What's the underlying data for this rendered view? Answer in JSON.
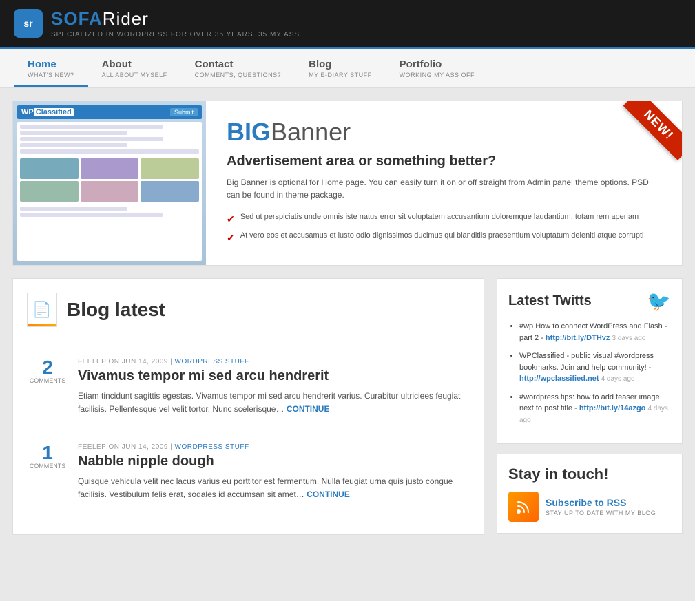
{
  "site": {
    "logo_abbr": "sr",
    "logo_name_part1": "SOFA",
    "logo_name_part2": "Rider",
    "tagline": "SPECIALIZED IN WORDPRESS FOR OVER 35 YEARS. 35 MY ASS."
  },
  "nav": {
    "items": [
      {
        "id": "home",
        "label": "Home",
        "sub": "WHAT'S NEW?",
        "active": true
      },
      {
        "id": "about",
        "label": "About",
        "sub": "ALL ABOUT MYSELF",
        "active": false
      },
      {
        "id": "contact",
        "label": "Contact",
        "sub": "COMMENTS, QUESTIONS?",
        "active": false
      },
      {
        "id": "blog",
        "label": "Blog",
        "sub": "MY E-DIARY STUFF",
        "active": false
      },
      {
        "id": "portfolio",
        "label": "Portfolio",
        "sub": "WORKING MY ASS OFF",
        "active": false
      }
    ]
  },
  "banner": {
    "title_big": "BIG",
    "title_rest": "Banner",
    "subtitle": "Advertisement area or something better?",
    "desc": "Big Banner is optional for Home page. You can easily turn it on or off straight from Admin panel theme options. PSD can be found in theme package.",
    "bullets": [
      "Sed ut perspiciatis unde omnis iste natus error sit voluptatem accusantium doloremque laudantium, totam rem aperiam",
      "At vero eos et accusamus et iusto odio dignissimos ducimus qui blanditiis praesentium voluptatum deleniti atque corrupti"
    ],
    "new_label": "NEW!"
  },
  "blog": {
    "section_title": "Blog latest",
    "posts": [
      {
        "id": "post-1",
        "author": "FEELEP",
        "date": "JUN 14, 2009",
        "category": "WORDPRESS STUFF",
        "title": "Vivamus tempor mi sed arcu hendrerit",
        "excerpt": "Etiam tincidunt sagittis egestas. Vivamus tempor mi sed arcu hendrerit varius. Curabitur ultriciees feugiat facilisis. Pellentesque vel velit tortor. Nunc scelerisque…",
        "continue": "CONTINUE",
        "comments": 2,
        "comments_label": "COMMENTS"
      },
      {
        "id": "post-2",
        "author": "FEELEP",
        "date": "JUN 14, 2009",
        "category": "WORDPRESS STUFF",
        "title": "Nabble nipple dough",
        "excerpt": "Quisque vehicula velit nec lacus varius eu porttitor est fermentum. Nulla feugiat urna quis justo congue facilisis. Vestibulum felis erat, sodales id accumsan sit amet…",
        "continue": "CONTINUE",
        "comments": 1,
        "comments_label": "COMMENTS"
      }
    ]
  },
  "sidebar": {
    "twitter": {
      "title": "Latest Twitts",
      "items": [
        {
          "text": "#wp How to connect WordPress and Flash - part 2 -",
          "link": "http://bit.ly/DTHvz",
          "days_ago": "3 days ago"
        },
        {
          "text": "WPClassified - public visual #wordpress bookmarks. Join and help community! -",
          "link": "http://wpclassified.net",
          "days_ago": "4 days ago"
        },
        {
          "text": "#wordpress tips: how to add teaser image next to post title -",
          "link": "http://bit.ly/14azgo",
          "days_ago": "4 days ago"
        }
      ]
    },
    "stay_touch": {
      "title": "Stay in touch!",
      "rss_label": "Subscribe to RSS",
      "rss_sub": "STAY UP TO DATE WITH MY BLOG"
    }
  }
}
